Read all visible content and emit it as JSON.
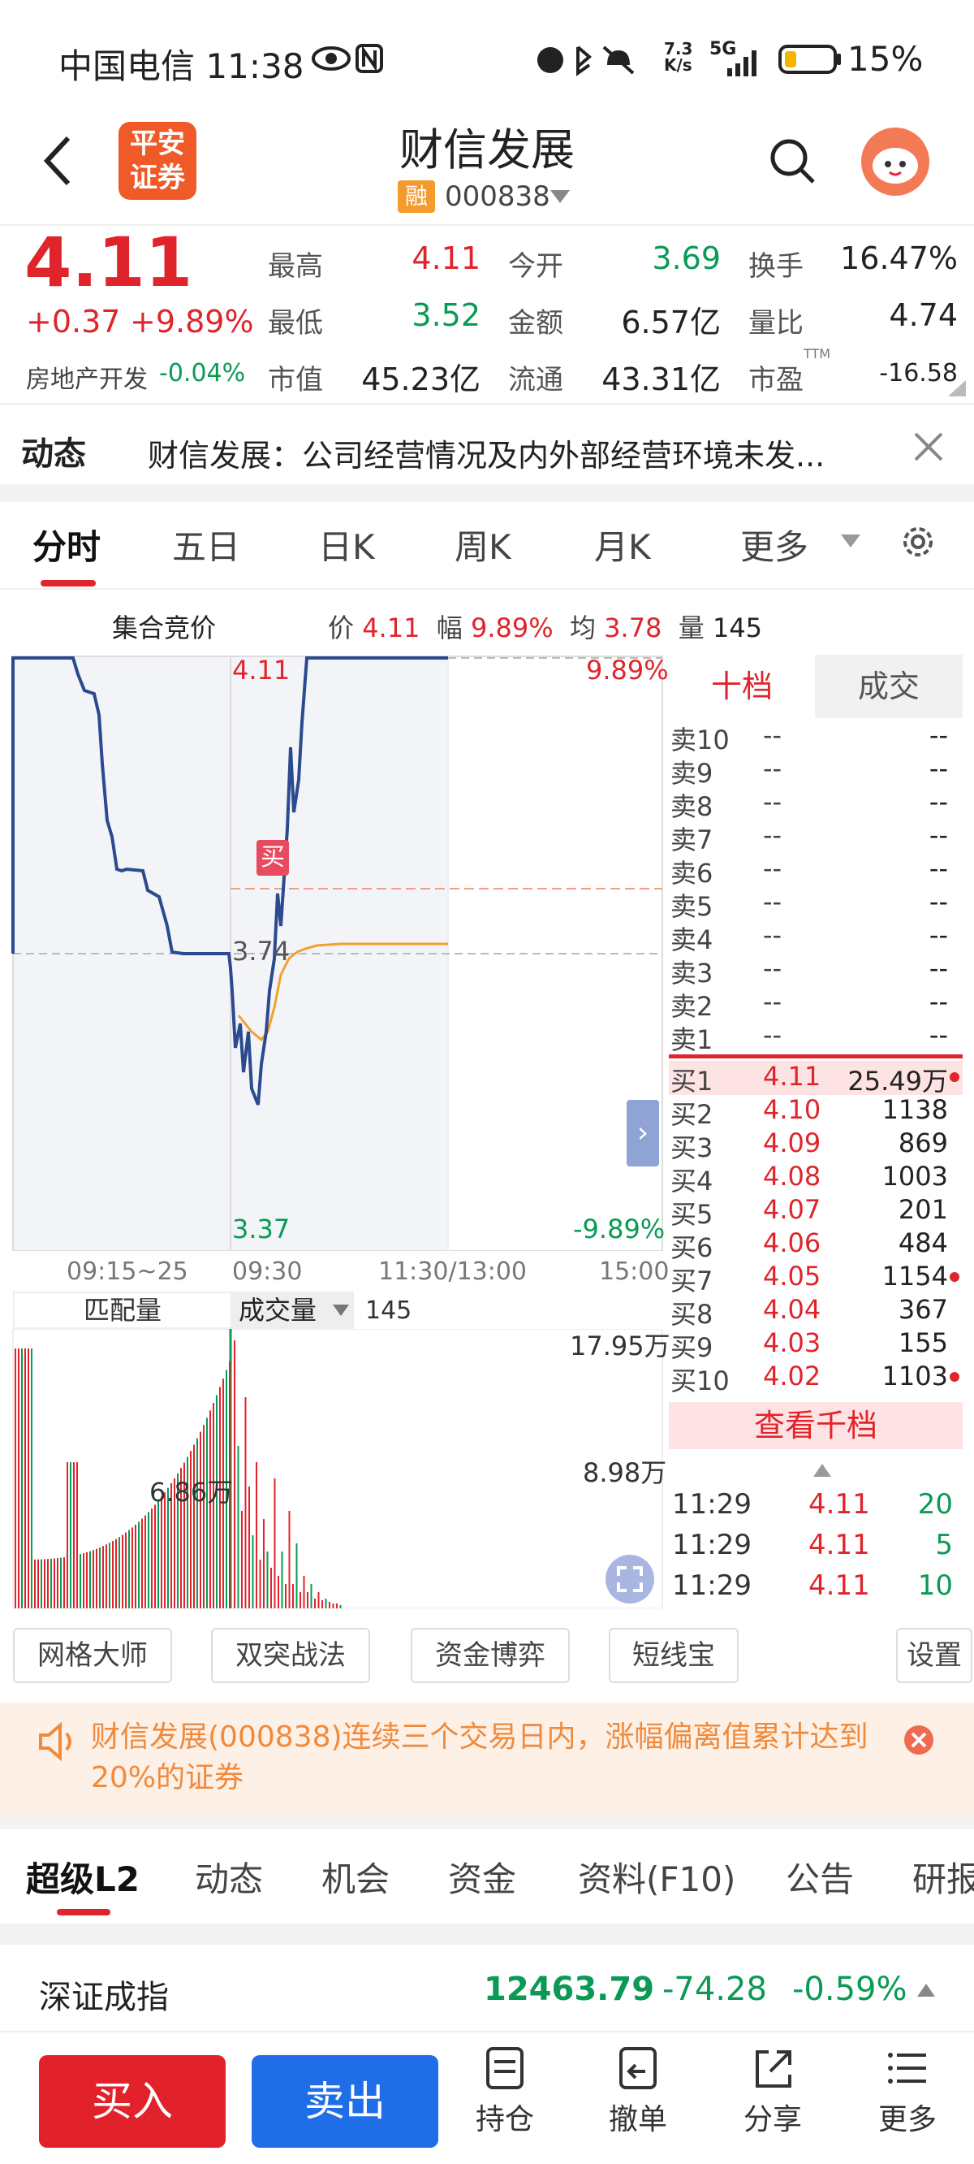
{
  "status": {
    "carrier": "中国电信",
    "time": "11:38",
    "net_speed_top": "7.3",
    "net_speed_bottom": "K/s",
    "signal": "5G",
    "battery": "15%"
  },
  "header": {
    "title": "财信发展",
    "rong_badge": "融",
    "code": "000838",
    "broker_logo_line1": "平安",
    "broker_logo_line2": "证券"
  },
  "quote": {
    "price": "4.11",
    "change": "+0.37",
    "change_pct": "+9.89%",
    "sector": "房地产开发",
    "sector_pct": "-0.04%",
    "cells": [
      {
        "label": "最高",
        "value": "4.11",
        "color": "red"
      },
      {
        "label": "今开",
        "value": "3.69",
        "color": "green"
      },
      {
        "label": "换手",
        "value": "16.47%",
        "color": "dark"
      },
      {
        "label": "最低",
        "value": "3.52",
        "color": "green"
      },
      {
        "label": "金额",
        "value": "6.57亿",
        "color": "dark"
      },
      {
        "label": "量比",
        "value": "4.74",
        "color": "dark"
      },
      {
        "label": "市值",
        "value": "45.23亿",
        "color": "dark"
      },
      {
        "label": "流通",
        "value": "43.31亿",
        "color": "dark"
      },
      {
        "label": "市盈",
        "value": "-16.58",
        "color": "dark",
        "sup": "TTM"
      }
    ]
  },
  "news": {
    "label": "动态",
    "text": "财信发展：公司经营情况及内外部经营环境未发..."
  },
  "chart_tabs": [
    "分时",
    "五日",
    "日K",
    "周K",
    "月K",
    "更多"
  ],
  "chart_info": {
    "title": "集合竞价",
    "price_label": "价",
    "price": "4.11",
    "range_label": "幅",
    "range": "9.89%",
    "avg_label": "均",
    "avg": "3.78",
    "vol_label": "量",
    "vol": "145"
  },
  "chart_labels": {
    "top_price": "4.11",
    "top_pct": "9.89%",
    "mid_price": "3.74",
    "bottom_price": "3.37",
    "bottom_pct": "-9.89%",
    "buy_marker": "买",
    "time_axis": [
      "09:15~25",
      "09:30",
      "11:30/13:00",
      "15:00"
    ]
  },
  "volume": {
    "match_label": "匹配量",
    "vol_label": "成交量",
    "vol_value": "145",
    "max": "17.95万",
    "mid": "8.98万",
    "auction": "6.86万"
  },
  "orderbook": {
    "tab_ten": "十档",
    "tab_trades": "成交",
    "asks": [
      {
        "l": "卖10",
        "p": "--",
        "v": "--"
      },
      {
        "l": "卖9",
        "p": "--",
        "v": "--"
      },
      {
        "l": "卖8",
        "p": "--",
        "v": "--"
      },
      {
        "l": "卖7",
        "p": "--",
        "v": "--"
      },
      {
        "l": "卖6",
        "p": "--",
        "v": "--"
      },
      {
        "l": "卖5",
        "p": "--",
        "v": "--"
      },
      {
        "l": "卖4",
        "p": "--",
        "v": "--"
      },
      {
        "l": "卖3",
        "p": "--",
        "v": "--"
      },
      {
        "l": "卖2",
        "p": "--",
        "v": "--"
      },
      {
        "l": "卖1",
        "p": "--",
        "v": "--"
      }
    ],
    "bids": [
      {
        "l": "买1",
        "p": "4.11",
        "v": "25.49万"
      },
      {
        "l": "买2",
        "p": "4.10",
        "v": "1138"
      },
      {
        "l": "买3",
        "p": "4.09",
        "v": "869"
      },
      {
        "l": "买4",
        "p": "4.08",
        "v": "1003"
      },
      {
        "l": "买5",
        "p": "4.07",
        "v": "201"
      },
      {
        "l": "买6",
        "p": "4.06",
        "v": "484"
      },
      {
        "l": "买7",
        "p": "4.05",
        "v": "1154"
      },
      {
        "l": "买8",
        "p": "4.04",
        "v": "367"
      },
      {
        "l": "买9",
        "p": "4.03",
        "v": "155"
      },
      {
        "l": "买10",
        "p": "4.02",
        "v": "1103"
      }
    ],
    "more": "查看千档",
    "trades": [
      {
        "t": "11:29",
        "p": "4.11",
        "v": "20"
      },
      {
        "t": "11:29",
        "p": "4.11",
        "v": "5"
      },
      {
        "t": "11:29",
        "p": "4.11",
        "v": "10"
      }
    ]
  },
  "tools": [
    "网格大师",
    "双突战法",
    "资金博弈",
    "短线宝",
    "设置"
  ],
  "notice": "财信发展(000838)连续三个交易日内，涨幅偏离值累计达到20%的证券",
  "bottom_tabs": [
    "超级L2",
    "动态",
    "机会",
    "资金",
    "资料(F10)",
    "公告",
    "研报"
  ],
  "index": {
    "name": "深证成指",
    "value": "12463.79",
    "change": "-74.28",
    "pct": "-0.59%"
  },
  "actions": {
    "buy": "买入",
    "sell": "卖出",
    "hold": "持仓",
    "cancel": "撤单",
    "share": "分享",
    "more": "更多"
  },
  "colors": {
    "up": "#e0242c",
    "down": "#0a9a55",
    "line": "#2b4a8f",
    "avg": "#f0a030",
    "buy_btn": "#e2222a",
    "sell_btn": "#1f6ee8"
  }
}
